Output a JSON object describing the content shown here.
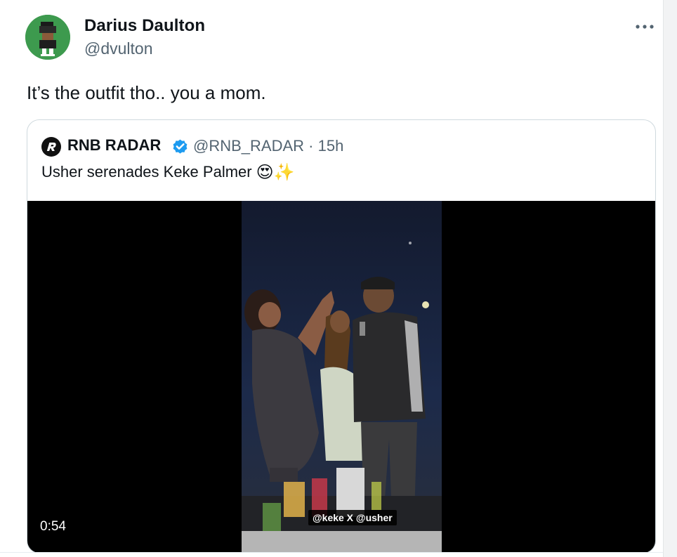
{
  "post": {
    "author_name": "Darius Daulton",
    "author_handle": "@dvulton",
    "text": "It’s the outfit tho.. you a mom.",
    "more_icon": "ellipsis-icon"
  },
  "quoted_post": {
    "author_name": "RNB RADAR",
    "author_handle": "@RNB_RADAR",
    "separator": "·",
    "time": "15h",
    "verified": true,
    "text": "Usher serenades Keke Palmer",
    "emojis": "😍✨",
    "video": {
      "duration": "0:54",
      "caption": "@keke X @usher"
    }
  },
  "colors": {
    "avatar_bg": "#3d9a4e",
    "verified_blue": "#1d9bf0",
    "secondary_text": "#536471"
  }
}
